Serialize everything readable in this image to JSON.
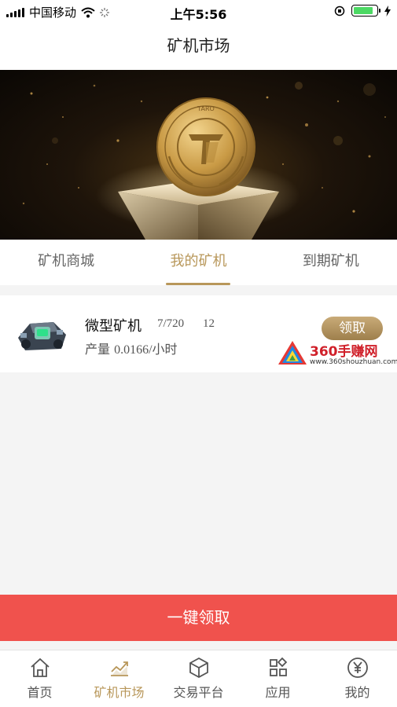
{
  "status_bar": {
    "carrier": "中国移动",
    "time": "上午5:56"
  },
  "header": {
    "title": "矿机市场"
  },
  "banner": {
    "coin_text": "TARO"
  },
  "tabs": [
    {
      "label": "矿机商城",
      "active": false
    },
    {
      "label": "我的矿机",
      "active": true
    },
    {
      "label": "到期矿机",
      "active": false
    }
  ],
  "miners": [
    {
      "name": "微型矿机",
      "progress": "7/720",
      "count": "12",
      "output_label": "产量",
      "output_value": "0.0166/小时",
      "claim_label": "领取"
    }
  ],
  "watermark": {
    "text": "360手赚网",
    "url": "www.360shouzhuan.com"
  },
  "claim_all_label": "一键领取",
  "bottom_nav": [
    {
      "label": "首页",
      "icon": "home-icon",
      "active": false
    },
    {
      "label": "矿机市场",
      "icon": "chart-icon",
      "active": true
    },
    {
      "label": "交易平台",
      "icon": "cube-icon",
      "active": false
    },
    {
      "label": "应用",
      "icon": "apps-icon",
      "active": false
    },
    {
      "label": "我的",
      "icon": "yen-icon",
      "active": false
    }
  ],
  "colors": {
    "accent_gold": "#b8975a",
    "claim_all_red": "#f0524d",
    "battery_green": "#4cd964"
  }
}
